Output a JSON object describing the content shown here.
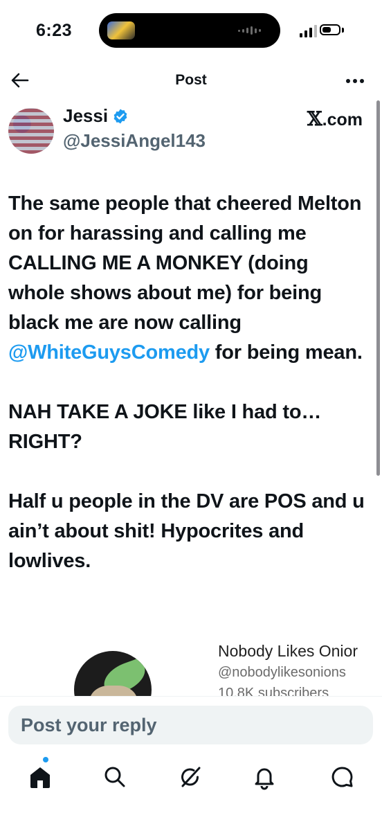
{
  "status_bar": {
    "time": "6:23"
  },
  "header": {
    "title": "Post"
  },
  "post": {
    "author_name": "Jessi",
    "author_handle": "@JessiAngel143",
    "source_label": "X.com",
    "paragraphs": [
      {
        "before": "The same people that cheered Melton on for harassing and calling me CALLING ME A MONKEY (doing whole shows about me) for being black me are now calling ",
        "mention": "@WhiteGuysComedy",
        "after": " for being mean."
      },
      {
        "before": "NAH TAKE A JOKE like I had to… RIGHT?",
        "mention": "",
        "after": ""
      },
      {
        "before": "Half u people in the DV are POS and u ain’t about shit! Hypocrites and lowlives.",
        "mention": "",
        "after": ""
      }
    ]
  },
  "embedded_card": {
    "title": "Nobody Likes Onior",
    "handle": "@nobodylikesonions",
    "subscribers": "10.8K subscribers"
  },
  "reply": {
    "placeholder": "Post your reply"
  },
  "bottom_nav": {
    "items": [
      "home-icon",
      "search-icon",
      "grok-icon",
      "notifications-icon",
      "messages-icon"
    ],
    "active": "home-icon"
  },
  "colors": {
    "accent": "#1d9bf0",
    "text": "#0f1419",
    "secondary": "#536471"
  }
}
